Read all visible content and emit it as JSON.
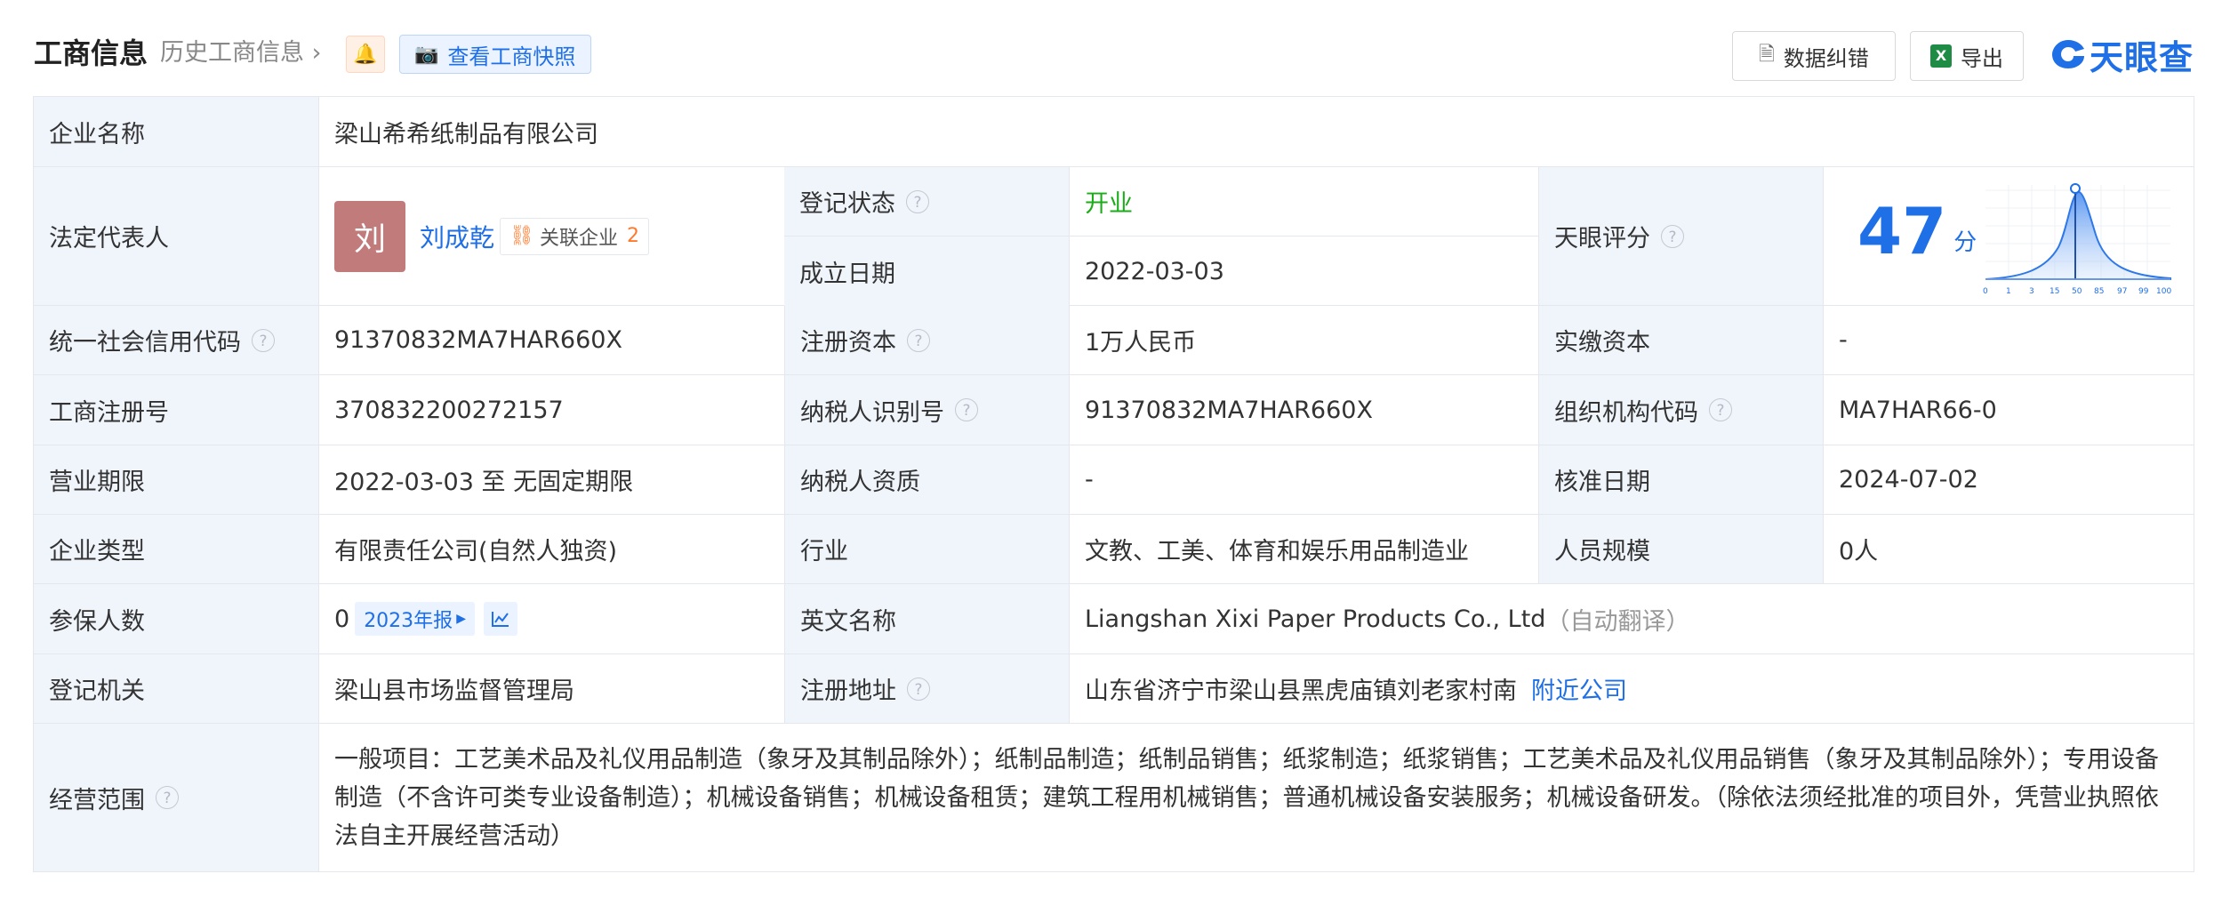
{
  "header": {
    "title": "工商信息",
    "history_link": "历史工商信息",
    "snapshot_button": "查看工商快照",
    "fix_button": "数据纠错",
    "export_button": "导出",
    "brand": "天眼查"
  },
  "rows": {
    "company_name": {
      "label": "企业名称",
      "value": "梁山希希纸制品有限公司"
    },
    "legal_rep": {
      "label": "法定代表人",
      "avatar_char": "刘",
      "name": "刘成乾",
      "related_label": "关联企业",
      "related_count": "2"
    },
    "reg_status": {
      "label": "登记状态",
      "value": "开业"
    },
    "found_date": {
      "label": "成立日期",
      "value": "2022-03-03"
    },
    "tianyan_score": {
      "label": "天眼评分",
      "score": "47",
      "unit": "分",
      "axis_ticks": [
        "0",
        "1",
        "3",
        "15",
        "50",
        "85",
        "97",
        "99",
        "100"
      ]
    },
    "credit_code": {
      "label": "统一社会信用代码",
      "value": "91370832MA7HAR660X"
    },
    "reg_capital": {
      "label": "注册资本",
      "value": "1万人民币"
    },
    "paid_capital": {
      "label": "实缴资本",
      "value": "-"
    },
    "biz_reg_no": {
      "label": "工商注册号",
      "value": "370832200272157"
    },
    "taxpayer_id": {
      "label": "纳税人识别号",
      "value": "91370832MA7HAR660X"
    },
    "org_code": {
      "label": "组织机构代码",
      "value": "MA7HAR66-0"
    },
    "biz_term": {
      "label": "营业期限",
      "value": "2022-03-03 至 无固定期限"
    },
    "taxpayer_qual": {
      "label": "纳税人资质",
      "value": "-"
    },
    "approve_date": {
      "label": "核准日期",
      "value": "2024-07-02"
    },
    "company_type": {
      "label": "企业类型",
      "value": "有限责任公司(自然人独资)"
    },
    "industry": {
      "label": "行业",
      "value": "文教、工美、体育和娱乐用品制造业"
    },
    "staff_size": {
      "label": "人员规模",
      "value": "0人"
    },
    "insured": {
      "label": "参保人数",
      "value": "0",
      "report": "2023年报"
    },
    "english_name": {
      "label": "英文名称",
      "value": "Liangshan Xixi Paper Products Co., Ltd",
      "note": "（自动翻译）"
    },
    "reg_authority": {
      "label": "登记机关",
      "value": "梁山县市场监督管理局"
    },
    "reg_address": {
      "label": "注册地址",
      "value": "山东省济宁市梁山县黑虎庙镇刘老家村南",
      "nearby": "附近公司"
    },
    "biz_scope": {
      "label": "经营范围",
      "value": "一般项目：工艺美术品及礼仪用品制造（象牙及其制品除外）；纸制品制造；纸制品销售；纸浆制造；纸浆销售；工艺美术品及礼仪用品销售（象牙及其制品除外）；专用设备制造（不含许可类专业设备制造）；机械设备销售；机械设备租赁；建筑工程用机械销售；普通机械设备安装服务；机械设备研发。（除依法须经批准的项目外，凭营业执照依法自主开展经营活动）"
    }
  },
  "colors": {
    "accent": "#1f6fe6",
    "label_bg": "#f0f5fc",
    "open_green": "#1aad19",
    "avatar": "#c27b7b"
  }
}
